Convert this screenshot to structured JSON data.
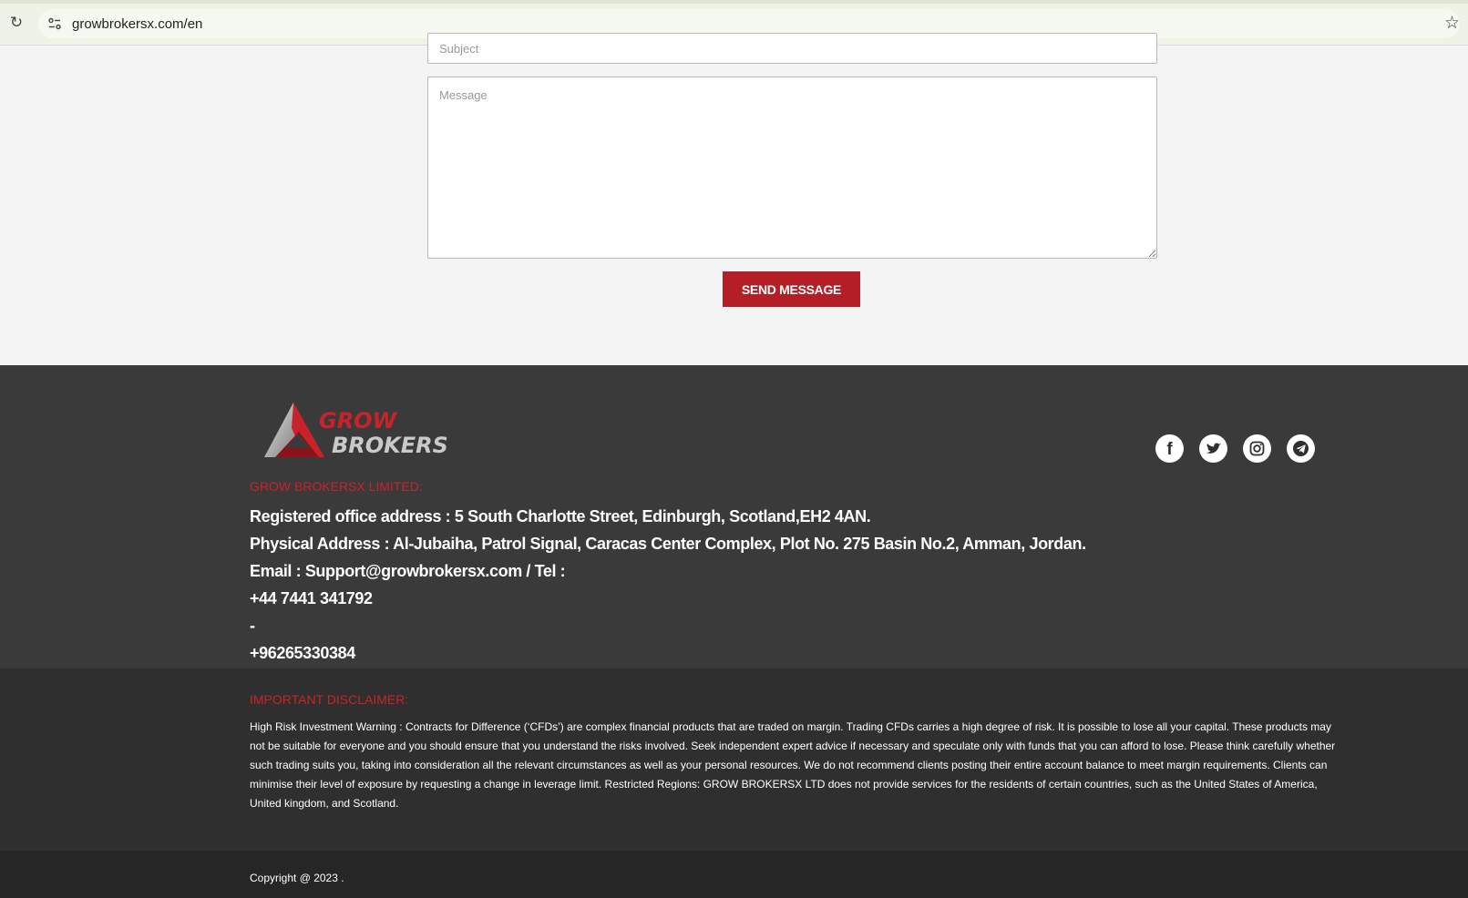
{
  "browser": {
    "url": "growbrokersx.com/en",
    "icons": [
      "reload-icon",
      "site-info-icon",
      "bookmark-star-icon"
    ]
  },
  "form": {
    "subject_placeholder": "Subject",
    "message_placeholder": "Message",
    "send_label": "SEND MESSAGE"
  },
  "footer": {
    "logo": {
      "line1": "GROW",
      "line2": "BROKERS"
    },
    "company_heading": "GROW BROKERSX LIMITED:",
    "registered_address": "Registered office address : 5 South Charlotte Street, Edinburgh, Scotland,EH2 4AN.",
    "physical_address": "Physical Address : Al-Jubaiha, Patrol Signal, Caracas Center Complex, Plot No. 275 Basin No.2, Amman, Jordan.",
    "email_line": "Email : Support@growbrokersx.com / Tel :",
    "phone1": "+44 7441 341792",
    "separator": "-",
    "phone2": "+96265330384",
    "socials": [
      "facebook-icon",
      "twitter-icon",
      "instagram-icon",
      "telegram-icon"
    ],
    "disclaimer_heading": "IMPORTANT DISCLAIMER:",
    "disclaimer_text": "High Risk Investment Warning : Contracts for Difference (‘CFDs’) are complex financial products that are traded on margin. Trading CFDs carries a high degree of risk. It is possible to lose all your capital. These products may not be suitable for everyone and you should ensure that you understand the risks involved. Seek independent expert advice if necessary and speculate only with funds that you can afford to lose. Please think carefully whether such trading suits you, taking into consideration all the relevant circumstances as well as your personal resources. We do not recommend clients posting their entire account balance to meet margin requirements. Clients can minimise their level of exposure by requesting a change in leverage limit. Restricted Regions: GROW BROKERSX LTD does not provide services for the residents of certain countries, such as the United States of America, United kingdom, and Scotland.",
    "copyright": "Copyright @ 2023 ."
  },
  "colors": {
    "brand_red": "#b41f27",
    "heading_red": "#c8232b",
    "footer_bg": "#3a3a3b",
    "disclaimer_bg": "#2f2f30",
    "copyright_bg": "#262627"
  }
}
